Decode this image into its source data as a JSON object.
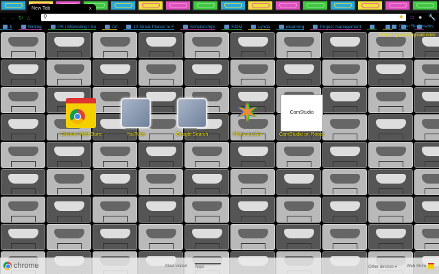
{
  "tab": {
    "title": "New Tab",
    "close": "×"
  },
  "toolbar": {
    "back": "←",
    "forward": "→",
    "reload": "↻",
    "home": "⌂",
    "omnibox_value": "",
    "search_icon": "search-icon",
    "star_icon": "star-icon"
  },
  "bookmarks": [
    "$",
    "Writing",
    "PR / Marketing / So",
    "Art",
    "10 Great Places to F",
    "Scholarships",
    "FIDM",
    "Lynda",
    "elearning",
    "Project management",
    "",
    "",
    "",
    ""
  ],
  "other_bookmarks": "Other Bookmarks",
  "account_email": "eileen.l.garcia@gmail.com",
  "apps": [
    {
      "label": "Chrome Web Store"
    },
    {
      "label": "YouTube"
    },
    {
      "label": "Google Search"
    },
    {
      "label": "Photo recolor"
    },
    {
      "label": "CamStudio on Roozz",
      "thumb_text": "CamStudio"
    }
  ],
  "footer": {
    "brand": "chrome",
    "tabs": [
      "Most visited",
      "Apps"
    ],
    "selected_tab": "Apps",
    "other_devices": "Other devices ▾",
    "web_store": "Web Store"
  },
  "colors": {
    "label": "#f0e000",
    "bookmark_text": "#3a8fd6",
    "chrome_green": "#2c8a2c"
  }
}
